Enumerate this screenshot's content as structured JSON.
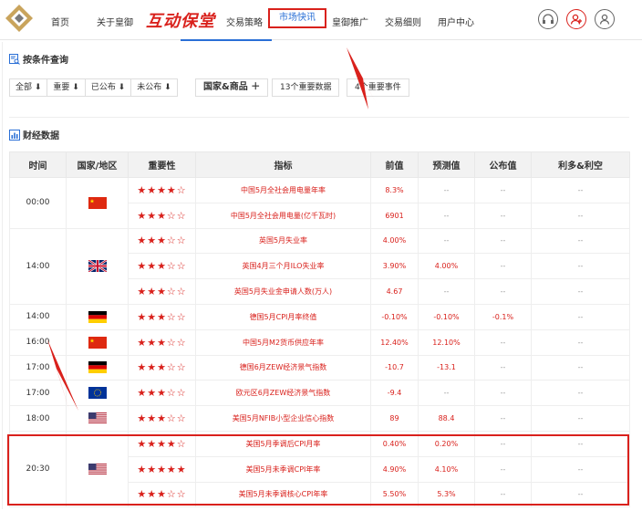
{
  "nav": {
    "items": [
      "首页",
      "关于皇御",
      "交易策略",
      "皇御推广",
      "交易细则",
      "用户中心"
    ],
    "brand": "互动保堂",
    "active": "市场快讯"
  },
  "filter": {
    "title": "按条件查询",
    "importance_buttons": [
      "全部 ⬇",
      "重要 ⬇",
      "已公布 ⬇",
      "未公布 ⬇"
    ],
    "country_button": "国家&商品 ＋",
    "data_count": "13个重要数据",
    "event_count": "4个重要事件"
  },
  "data_section": {
    "title": "财经数据"
  },
  "table": {
    "headers": [
      "时间",
      "国家/地区",
      "重要性",
      "指标",
      "前值",
      "预测值",
      "公布值",
      "利多&利空"
    ],
    "groups": [
      {
        "time": "00:00",
        "flag": "cn",
        "rows": [
          {
            "stars": 4,
            "indicator": "中国5月全社会用电量年率",
            "prev": "8.3%",
            "forecast": "--",
            "actual": "--",
            "impact": "--"
          },
          {
            "stars": 3,
            "indicator": "中国5月全社会用电量(亿千瓦时)",
            "prev": "6901",
            "forecast": "--",
            "actual": "--",
            "impact": "--"
          }
        ]
      },
      {
        "time": "14:00",
        "flag": "uk",
        "rows": [
          {
            "stars": 3,
            "indicator": "英国5月失业率",
            "prev": "4.00%",
            "forecast": "--",
            "actual": "--",
            "impact": "--"
          },
          {
            "stars": 3,
            "indicator": "英国4月三个月ILO失业率",
            "prev": "3.90%",
            "forecast": "4.00%",
            "actual": "--",
            "impact": "--"
          },
          {
            "stars": 3,
            "indicator": "英国5月失业金申请人数(万人)",
            "prev": "4.67",
            "forecast": "--",
            "actual": "--",
            "impact": "--"
          }
        ]
      },
      {
        "time": "14:00",
        "flag": "de",
        "rows": [
          {
            "stars": 3,
            "indicator": "德国5月CPI月率终值",
            "prev": "-0.10%",
            "forecast": "-0.10%",
            "actual": "-0.1%",
            "impact": "--"
          }
        ]
      },
      {
        "time": "16:00",
        "flag": "cn",
        "rows": [
          {
            "stars": 3,
            "indicator": "中国5月M2货币供应年率",
            "prev": "12.40%",
            "forecast": "12.10%",
            "actual": "--",
            "impact": "--"
          }
        ]
      },
      {
        "time": "17:00",
        "flag": "de",
        "rows": [
          {
            "stars": 3,
            "indicator": "德国6月ZEW经济景气指数",
            "prev": "-10.7",
            "forecast": "-13.1",
            "actual": "--",
            "impact": "--"
          }
        ]
      },
      {
        "time": "17:00",
        "flag": "eu",
        "rows": [
          {
            "stars": 3,
            "indicator": "欧元区6月ZEW经济景气指数",
            "prev": "-9.4",
            "forecast": "--",
            "actual": "--",
            "impact": "--"
          }
        ]
      },
      {
        "time": "18:00",
        "flag": "us",
        "rows": [
          {
            "stars": 3,
            "indicator": "美国5月NFIB小型企业信心指数",
            "prev": "89",
            "forecast": "88.4",
            "actual": "--",
            "impact": "--"
          }
        ]
      },
      {
        "time": "20:30",
        "flag": "us",
        "rows": [
          {
            "stars": 4,
            "indicator": "美国5月季调后CPI月率",
            "prev": "0.40%",
            "forecast": "0.20%",
            "actual": "--",
            "impact": "--"
          },
          {
            "stars": 5,
            "indicator": "美国5月未季调CPI年率",
            "prev": "4.90%",
            "forecast": "4.10%",
            "actual": "--",
            "impact": "--"
          },
          {
            "stars": 3,
            "indicator": "美国5月未季调核心CPI年率",
            "prev": "5.50%",
            "forecast": "5.3%",
            "actual": "--",
            "impact": "--"
          }
        ]
      }
    ]
  },
  "colors": {
    "accent_red": "#d9211c",
    "link_blue": "#2a6fd6"
  }
}
